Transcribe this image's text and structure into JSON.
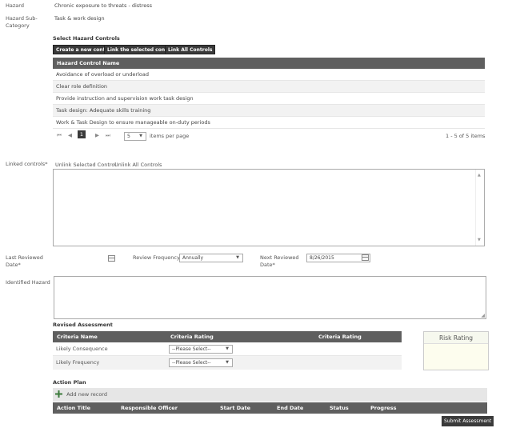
{
  "hazard": {
    "label": "Hazard",
    "value": "Chronic exposure to threats - distress",
    "subcategory_label_line1": "Hazard Sub-",
    "subcategory_label_line2": "Category",
    "subcategory_value": "Task & work design"
  },
  "controls": {
    "title": "Select Hazard Controls",
    "buttons": {
      "create": "Create a new control",
      "link_selected": "Link the selected control",
      "link_all": "Link All Controls"
    },
    "column_header": "Hazard Control Name",
    "rows": [
      "Avoidance of overload or underload",
      "Clear role definition",
      "Provide instruction and supervision work task design",
      "Task design: Adequate skills training",
      "Work & Task Design to ensure manageable on-duty periods"
    ],
    "pager": {
      "first": "⏮",
      "prev": "◀",
      "current_page": "1",
      "next": "▶",
      "last": "⏭",
      "page_size": "5",
      "items_per_page_label": "items per page",
      "summary": "1 - 5 of 5 items"
    }
  },
  "linked": {
    "label": "Linked controls*",
    "unlink_selected": "Unlink Selected Control",
    "unlink_all": "Unlink All Controls"
  },
  "review": {
    "last_reviewed_line1": "Last Reviewed",
    "last_reviewed_line2": "Date*",
    "frequency_label": "Review Frequency*",
    "frequency_value": "Annually",
    "next_reviewed_line1": "Next Reviewed",
    "next_reviewed_line2": "Date*",
    "next_reviewed_value": "8/26/2015"
  },
  "identified": {
    "label": "Identified Hazard"
  },
  "revised": {
    "title": "Revised Assessment",
    "col_name": "Criteria Name",
    "col_rating1": "Criteria Rating",
    "col_rating2": "Criteria Rating",
    "rows": [
      {
        "name": "Likely Consequence",
        "select": "--Please Select--"
      },
      {
        "name": "Likely Frequency",
        "select": "--Please Select--"
      }
    ],
    "risk_rating_label": "Risk Rating"
  },
  "action_plan": {
    "title": "Action Plan",
    "add_label": "Add new record",
    "columns": [
      "Action Title",
      "Responsible Officer",
      "Start Date",
      "End Date",
      "Status",
      "Progress"
    ]
  },
  "submit_label": "Submit Assessment",
  "colors": {
    "header_bg": "#5f5f5f",
    "button_bg": "#3a3a3a",
    "risk_rating_bg": "#fdfdee",
    "risk_rating_header_bg": "#f6f8ee",
    "add_icon": "#3b7a3b"
  }
}
